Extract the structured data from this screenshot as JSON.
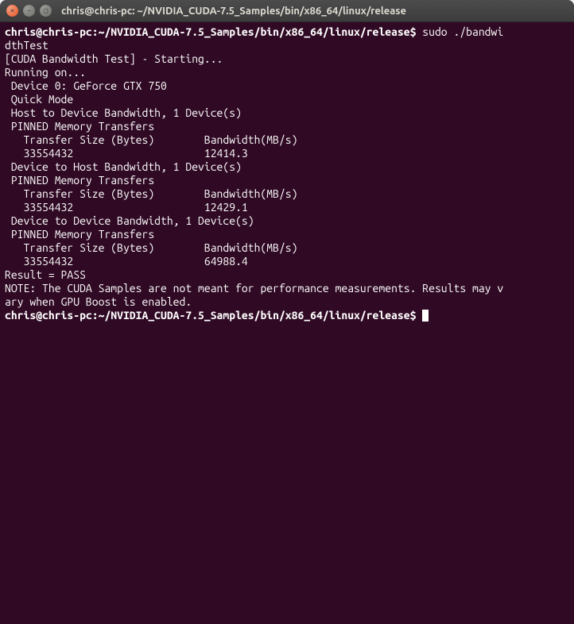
{
  "window": {
    "title": "chris@chris-pc: ~/NVIDIA_CUDA-7.5_Samples/bin/x86_64/linux/release"
  },
  "prompt1": "chris@chris-pc:~/NVIDIA_CUDA-7.5_Samples/bin/x86_64/linux/release$ ",
  "cmd1a": "sudo ./bandwi",
  "cmd1b": "dthTest",
  "out": {
    "l1": "[CUDA Bandwidth Test] - Starting...",
    "l2": "Running on...",
    "l3": "",
    "l4": " Device 0: GeForce GTX 750",
    "l5": " Quick Mode",
    "l6": "",
    "l7": " Host to Device Bandwidth, 1 Device(s)",
    "l8": " PINNED Memory Transfers",
    "l9": "   Transfer Size (Bytes)        Bandwidth(MB/s)",
    "l10": "   33554432                     12414.3",
    "l11": "",
    "l12": " Device to Host Bandwidth, 1 Device(s)",
    "l13": " PINNED Memory Transfers",
    "l14": "   Transfer Size (Bytes)        Bandwidth(MB/s)",
    "l15": "   33554432                     12429.1",
    "l16": "",
    "l17": " Device to Device Bandwidth, 1 Device(s)",
    "l18": " PINNED Memory Transfers",
    "l19": "   Transfer Size (Bytes)        Bandwidth(MB/s)",
    "l20": "   33554432                     64988.4",
    "l21": "",
    "l22": "Result = PASS",
    "l23": "",
    "l24": "NOTE: The CUDA Samples are not meant for performance measurements. Results may v",
    "l25": "ary when GPU Boost is enabled.",
    "prompt2": "chris@chris-pc:~/NVIDIA_CUDA-7.5_Samples/bin/x86_64/linux/release$ "
  }
}
